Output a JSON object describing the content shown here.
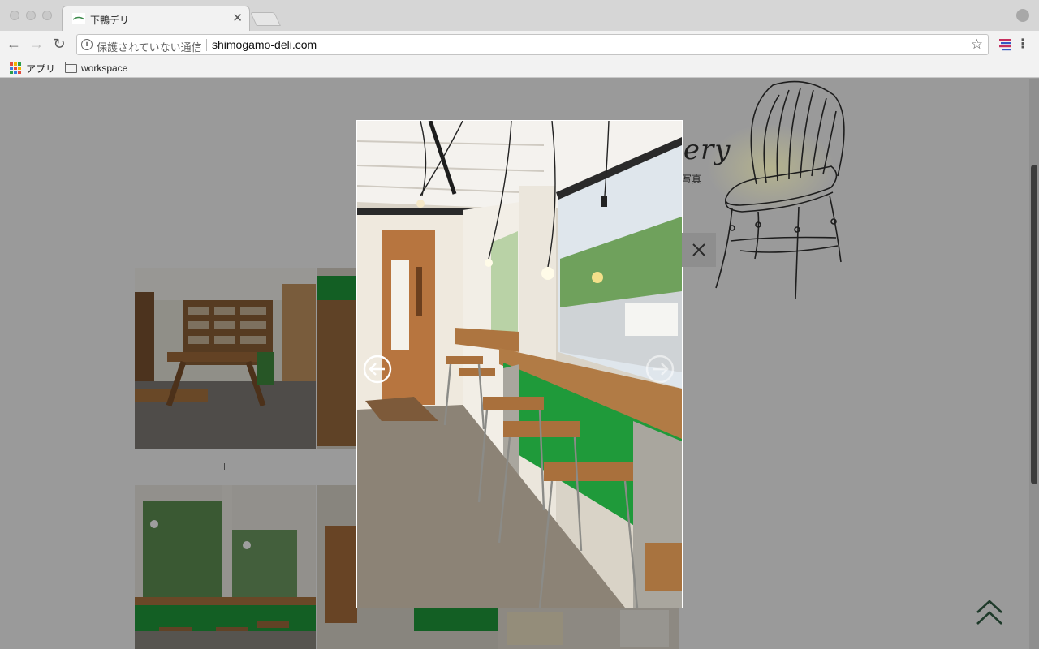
{
  "browser": {
    "tab_title": "下鴨デリ",
    "security_label": "保護されていない通信",
    "url": "shimogamo-deli.com",
    "bookmarks": {
      "apps_label": "アプリ",
      "folder_label": "workspace"
    }
  },
  "page": {
    "heading_fragment": "lery",
    "subheading_fragment": "写真"
  },
  "colors": {
    "overlay_gray": "#9a9a9a",
    "counter_green": "#1f9a3a",
    "wood": "#b5773f",
    "page_top_arrow": "#1e3a2a"
  },
  "icons": {
    "back": "arrow-left-icon",
    "forward": "arrow-right-icon",
    "reload": "reload-icon",
    "info": "info-icon",
    "bookmark": "star-icon",
    "menu": "kebab-menu-icon",
    "close": "close-icon",
    "prev": "circle-arrow-left-icon",
    "next": "circle-arrow-right-icon",
    "to_top": "double-chevron-up-icon"
  }
}
